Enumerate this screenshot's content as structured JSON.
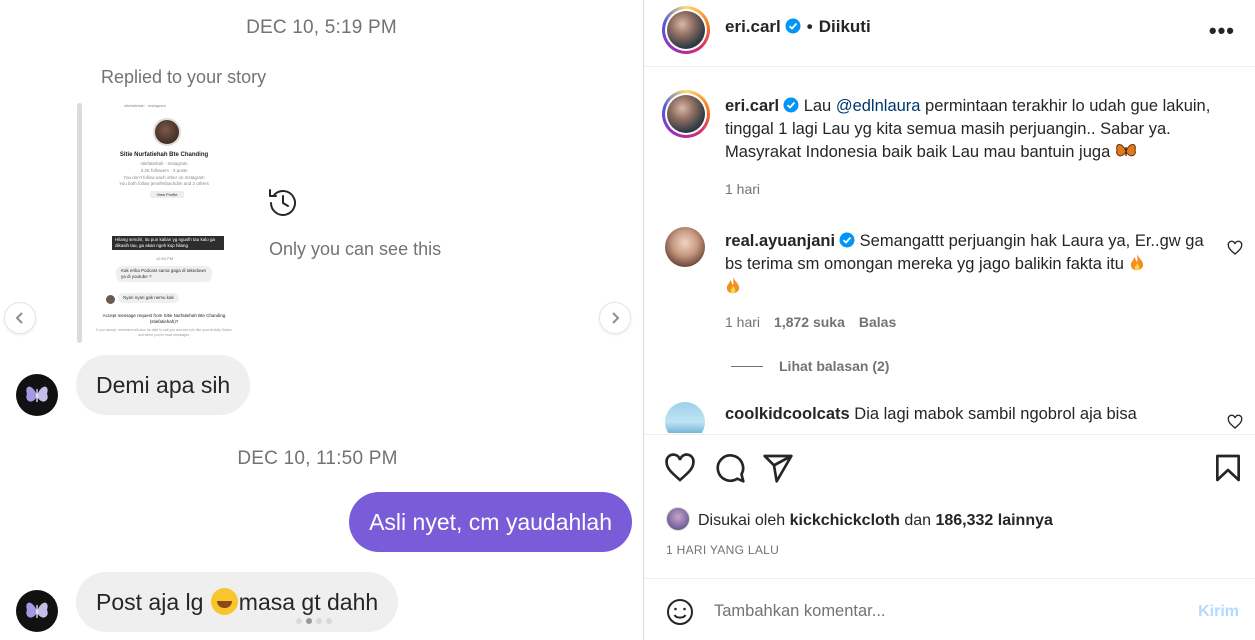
{
  "dm": {
    "timestamp_1": "DEC 10, 5:19 PM",
    "replied_label": "Replied to your story",
    "story_preview": {
      "name": "Sitie Nurfatiehah Bte Chanding",
      "handle": "stiefatiehah · Instagram",
      "stats": "3.2K followers · 3 posts",
      "mutual_1": "You don't follow each other on Instagram",
      "mutual_2": "You both follow jenniferbachdim and 2 others",
      "view_profile": "View Profile",
      "story_text": "Hilang sendiri, itu pun kalian yg nguslh tau kalo ga dikasih tau, ga akan ngeh kop hilang",
      "time_small": "12:54 PM",
      "msg_1": "Kak erika\nPodcast sama gaga di takedown ya di youtube ?",
      "msg_2": "Nyari nyari gak nemu kak",
      "accept_text": "Accept message request from Sitie Nurfatiehah Bte Chanding (stiefatiehah)?",
      "fine_print": "If you accept, members will also be able to call you and see info like your Activity Status and when you've read messages."
    },
    "only_you": "Only you can see this",
    "msg_in_1": "Demi apa sih",
    "timestamp_2": "DEC 10, 11:50 PM",
    "msg_out_1": "Asli nyet, cm yaudahlah",
    "msg_in_2_a": "Post aja lg ",
    "msg_in_2_b": "masa gt dahh"
  },
  "post": {
    "header": {
      "username": "eri.carl",
      "dot": "•",
      "follow_status": "Diikuti",
      "more": "•••"
    },
    "caption": {
      "username": "eri.carl",
      "pre": " Lau ",
      "mention": "@edlnlaura",
      "text": " permintaan terakhir lo udah gue lakuin, tinggal 1 lagi Lau yg kita semua masih perjuangin.. Sabar ya. Masyrakat Indonesia baik baik Lau mau bantuin juga ",
      "time": "1 hari"
    },
    "comments": [
      {
        "username": "real.ayuanjani",
        "text": " Semangattt perjuangin hak Laura ya, Er..gw ga bs terima sm omongan mereka yg jago balikin fakta itu ",
        "time": "1 hari",
        "likes": "1,872 suka",
        "reply": "Balas",
        "view_replies": "Lihat balasan (2)"
      },
      {
        "username": "coolkidcoolcats",
        "text": " Dia lagi mabok sambil ngobrol aja bisa"
      }
    ],
    "liked_by": {
      "prefix": "Disukai oleh ",
      "user": "kickchickcloth",
      "middle": " dan ",
      "others": "186,332 lainnya"
    },
    "posted_when": "1 HARI YANG LALU",
    "comment_box": {
      "placeholder": "Tambahkan komentar...",
      "post_label": "Kirim"
    }
  },
  "colors": {
    "outgoing_bubble": "#7a5bd8",
    "incoming_bubble": "#efefef",
    "verified": "#0095f6",
    "post_button_disabled": "#b3dbff",
    "mention": "#00376b"
  },
  "icons": [
    "history-icon",
    "chevron-left-icon",
    "chevron-right-icon",
    "verified-badge-icon",
    "heart-icon",
    "comment-icon",
    "share-icon",
    "bookmark-icon",
    "emoji-icon",
    "butterfly-emoji",
    "fire-emoji",
    "rofl-emoji"
  ]
}
